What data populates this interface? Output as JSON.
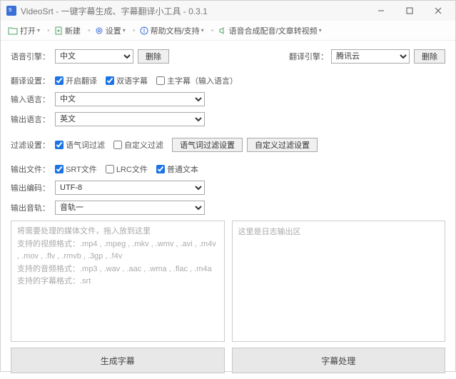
{
  "window": {
    "title": "VideoSrt - 一键字幕生成、字幕翻译小工具 - 0.3.1"
  },
  "toolbar": {
    "open": "打开",
    "new": "新建",
    "settings": "设置",
    "help": "帮助文档/支持",
    "tts": "语音合成配音/文章转视频"
  },
  "engine_row": {
    "speech_label": "语音引擎：",
    "speech_value": "中文",
    "delete_btn": "删除",
    "trans_label": "翻译引擎：",
    "trans_value": "腾讯云"
  },
  "trans_settings": {
    "label": "翻译设置：",
    "enable": "开启翻译",
    "bilingual": "双语字幕",
    "main_sub": "主字幕（输入语言）"
  },
  "input_lang": {
    "label": "输入语言：",
    "value": "中文"
  },
  "output_lang": {
    "label": "输出语言：",
    "value": "英文"
  },
  "filter": {
    "label": "过滤设置：",
    "modal": "语气词过滤",
    "custom": "自定义过滤",
    "modal_btn": "语气词过滤设置",
    "custom_btn": "自定义过滤设置"
  },
  "output_file": {
    "label": "输出文件：",
    "srt": "SRT文件",
    "lrc": "LRC文件",
    "txt": "普通文本"
  },
  "encoding": {
    "label": "输出编码：",
    "value": "UTF-8"
  },
  "track": {
    "label": "输出音轨：",
    "value": "音轨一"
  },
  "drop": {
    "line1": "将需要处理的媒体文件，拖入放到这里",
    "line2": "支持的视频格式：.mp4 , .mpeg , .mkv , .wmv , .avi , .m4v , .mov , .flv , .rmvb , .3gp , .f4v",
    "line3": "支持的音频格式：.mp3 , .wav , .aac , .wma , .flac , .m4a",
    "line4": "支持的字幕格式：.srt"
  },
  "log": {
    "placeholder": "这里是日志输出区"
  },
  "actions": {
    "generate": "生成字幕",
    "process": "字幕处理"
  }
}
